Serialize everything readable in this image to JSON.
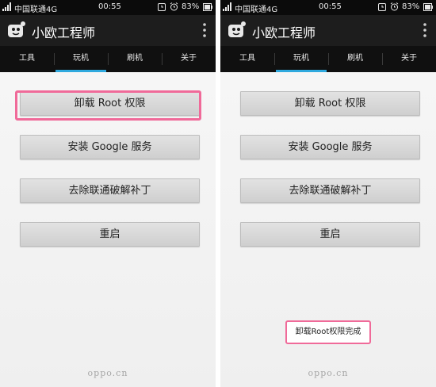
{
  "status_bar": {
    "carrier": "中国联通4G",
    "time": "00:55",
    "battery": "83%"
  },
  "app": {
    "title": "小欧工程师"
  },
  "tabs": [
    {
      "label": "工具"
    },
    {
      "label": "玩机"
    },
    {
      "label": "刷机"
    },
    {
      "label": "关于"
    }
  ],
  "buttons": {
    "uninstall_root": "卸载 Root 权限",
    "install_google": "安装 Google 服务",
    "remove_unicom_patch": "去除联通破解补丁",
    "reboot": "重启"
  },
  "toast": {
    "message": "卸载Root权限完成"
  },
  "watermark": "oppo.cn",
  "colors": {
    "accent": "#2fa9de",
    "highlight": "#f06a99",
    "appbar": "#1d1d1d"
  }
}
